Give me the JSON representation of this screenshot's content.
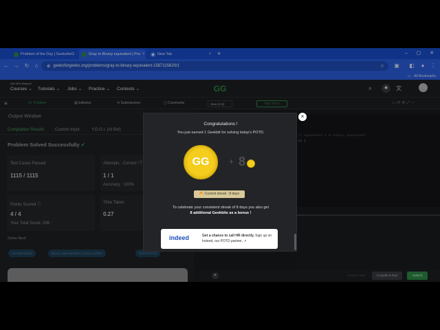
{
  "browser": {
    "tabs": [
      {
        "label": "Problem of the Day | GeeksforG",
        "close": "×"
      },
      {
        "label": "Gray to Binary equivalent | Pra",
        "close": "×"
      },
      {
        "label": "New Tab",
        "close": "×"
      }
    ],
    "new_tab": "+",
    "window_controls": {
      "minimize": "–",
      "maximize": "▢",
      "close": "✕"
    },
    "nav": {
      "back": "←",
      "forward": "→",
      "reload": "↻",
      "home": "⌂"
    },
    "url": "geeksforgeeks.org/problems/gray-to-binary-equivalent-1587115620/1",
    "bookmarks_label": "All Bookmarks"
  },
  "site": {
    "promo": "Get 90% Refund!",
    "menu": [
      "Courses",
      "Tutorials",
      "Jobs",
      "Practice",
      "Contests"
    ],
    "logo_text": "GG"
  },
  "toolbar": {
    "tabs": [
      "Problem",
      "Editorial",
      "Submissions",
      "Comments"
    ],
    "language": "Java (1.8)",
    "timer": "Start Timer"
  },
  "output": {
    "title": "Output Window",
    "tabs": [
      "Compilation Results",
      "Custom Input",
      "Y.O.G.I. (AI Bot)"
    ],
    "status": "Problem Solved Successfully",
    "test_cases_label": "Test Cases Passed",
    "test_cases_value": "1115 / 1115",
    "attempts_label": "Attempts : Correct / T",
    "attempts_value": "1 / 1",
    "accuracy": "Accuracy : 100%",
    "points_label": "Points Scored",
    "points_value": "4 / 4",
    "total_score": "Your Total Score: 296",
    "time_label": "Time Taken",
    "time_value": "0.27",
    "solve_next_label": "Solve Next",
    "solve_next": [
      "Set Operations",
      "Binary representation of next number",
      "Check set bit"
    ]
  },
  "editor": {
    "code_lines": [
      "// equivalent # to binary equivalent",
      "n) {"
    ],
    "custom_input": "Custom Input",
    "compile_button": "Compile & Run",
    "submit_button": "Submit"
  },
  "modal": {
    "title": "Congratulations !",
    "subtitle": "You just earned 1 Geekbit for solving today's POTD.",
    "plus": "+",
    "eight": "8",
    "streak": "Current streak : 8 days",
    "celebrate": "To celebrate your consistent streak of 8 days you also get",
    "bonus": "8 additional Geekbits as a bonus !",
    "close": "×",
    "ad": {
      "brand": "indeed",
      "headline": "Get a chance to call HR directly.",
      "body": "Sign up on Indeed, our POTD partner."
    }
  },
  "colors": {
    "accent": "#2f8d46",
    "chrome": "#2b62e3",
    "coin": "#f4cd1d"
  }
}
